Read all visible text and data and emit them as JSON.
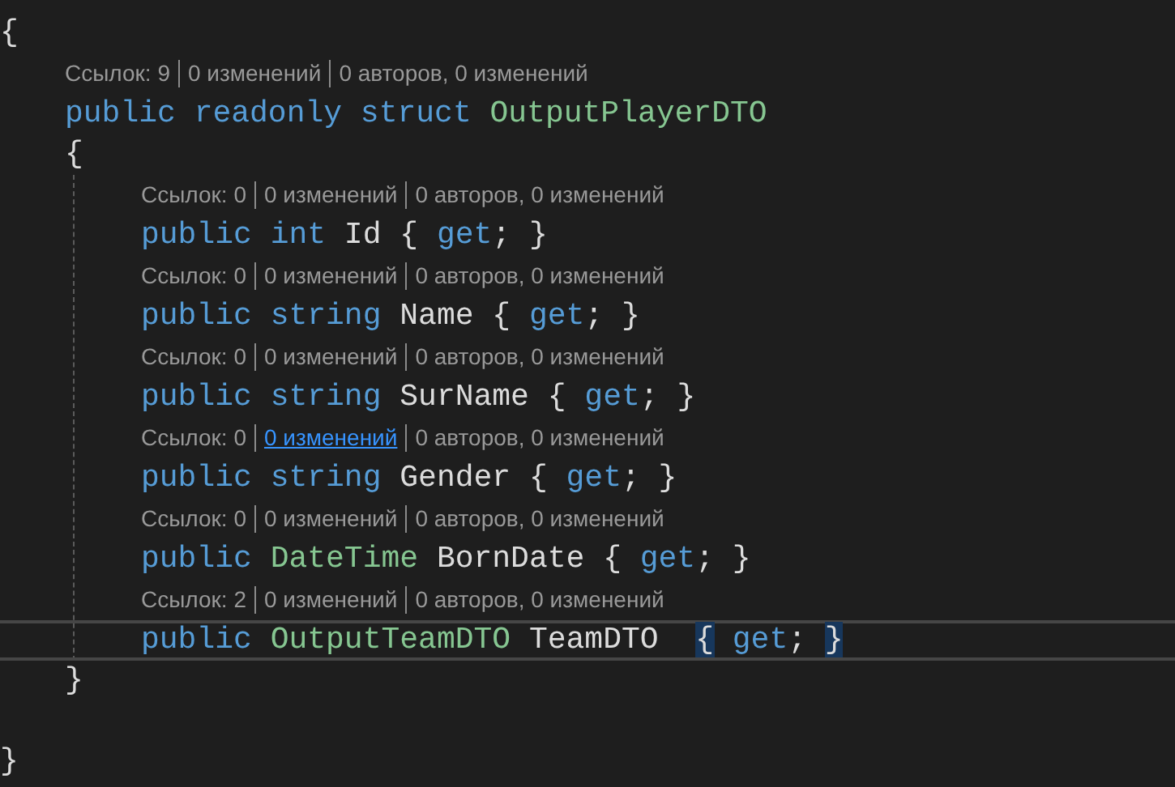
{
  "lines": [
    {
      "kind": "code",
      "current": false,
      "tokens": [
        {
          "text": "{",
          "kind": "plain",
          "matched": false
        }
      ],
      "children": [
        {
          "kind": "lens",
          "parts": [
            {
              "text": "Ссылок: 9",
              "link": false
            },
            {
              "text": "0 изменений",
              "link": false
            },
            {
              "text": "0 авторов, 0 изменений",
              "link": false
            }
          ]
        },
        {
          "kind": "code",
          "current": false,
          "tokens": [
            {
              "text": "public readonly struct ",
              "kind": "keyword",
              "matched": false
            },
            {
              "text": "OutputPlayerDTO",
              "kind": "type",
              "matched": false
            }
          ]
        },
        {
          "kind": "code",
          "current": false,
          "tokens": [
            {
              "text": "{",
              "kind": "plain",
              "matched": false
            }
          ],
          "children": [
            {
              "kind": "lens",
              "parts": [
                {
                  "text": "Ссылок: 0",
                  "link": false
                },
                {
                  "text": "0 изменений",
                  "link": false
                },
                {
                  "text": "0 авторов, 0 изменений",
                  "link": false
                }
              ]
            },
            {
              "kind": "code",
              "current": false,
              "tokens": [
                {
                  "text": "public int ",
                  "kind": "keyword",
                  "matched": false
                },
                {
                  "text": "Id { ",
                  "kind": "plain",
                  "matched": false
                },
                {
                  "text": "get",
                  "kind": "keyword",
                  "matched": false
                },
                {
                  "text": "; }",
                  "kind": "plain",
                  "matched": false
                }
              ]
            },
            {
              "kind": "lens",
              "parts": [
                {
                  "text": "Ссылок: 0",
                  "link": false
                },
                {
                  "text": "0 изменений",
                  "link": false
                },
                {
                  "text": "0 авторов, 0 изменений",
                  "link": false
                }
              ]
            },
            {
              "kind": "code",
              "current": false,
              "tokens": [
                {
                  "text": "public string ",
                  "kind": "keyword",
                  "matched": false
                },
                {
                  "text": "Name { ",
                  "kind": "plain",
                  "matched": false
                },
                {
                  "text": "get",
                  "kind": "keyword",
                  "matched": false
                },
                {
                  "text": "; }",
                  "kind": "plain",
                  "matched": false
                }
              ]
            },
            {
              "kind": "lens",
              "parts": [
                {
                  "text": "Ссылок: 0",
                  "link": false
                },
                {
                  "text": "0 изменений",
                  "link": false
                },
                {
                  "text": "0 авторов, 0 изменений",
                  "link": false
                }
              ]
            },
            {
              "kind": "code",
              "current": false,
              "tokens": [
                {
                  "text": "public string ",
                  "kind": "keyword",
                  "matched": false
                },
                {
                  "text": "SurName { ",
                  "kind": "plain",
                  "matched": false
                },
                {
                  "text": "get",
                  "kind": "keyword",
                  "matched": false
                },
                {
                  "text": "; }",
                  "kind": "plain",
                  "matched": false
                }
              ]
            },
            {
              "kind": "lens",
              "parts": [
                {
                  "text": "Ссылок: 0",
                  "link": false
                },
                {
                  "text": "0 изменений",
                  "link": true
                },
                {
                  "text": "0 авторов, 0 изменений",
                  "link": false
                }
              ]
            },
            {
              "kind": "code",
              "current": false,
              "tokens": [
                {
                  "text": "public string ",
                  "kind": "keyword",
                  "matched": false
                },
                {
                  "text": "Gender { ",
                  "kind": "plain",
                  "matched": false
                },
                {
                  "text": "get",
                  "kind": "keyword",
                  "matched": false
                },
                {
                  "text": "; }",
                  "kind": "plain",
                  "matched": false
                }
              ]
            },
            {
              "kind": "lens",
              "parts": [
                {
                  "text": "Ссылок: 0",
                  "link": false
                },
                {
                  "text": "0 изменений",
                  "link": false
                },
                {
                  "text": "0 авторов, 0 изменений",
                  "link": false
                }
              ]
            },
            {
              "kind": "code",
              "current": false,
              "tokens": [
                {
                  "text": "public ",
                  "kind": "keyword",
                  "matched": false
                },
                {
                  "text": "DateTime ",
                  "kind": "type",
                  "matched": false
                },
                {
                  "text": "BornDate { ",
                  "kind": "plain",
                  "matched": false
                },
                {
                  "text": "get",
                  "kind": "keyword",
                  "matched": false
                },
                {
                  "text": "; }",
                  "kind": "plain",
                  "matched": false
                }
              ]
            },
            {
              "kind": "lens",
              "parts": [
                {
                  "text": "Ссылок: 2",
                  "link": false
                },
                {
                  "text": "0 изменений",
                  "link": false
                },
                {
                  "text": "0 авторов, 0 изменений",
                  "link": false
                }
              ]
            },
            {
              "kind": "code",
              "current": true,
              "tokens": [
                {
                  "text": "public ",
                  "kind": "keyword",
                  "matched": false
                },
                {
                  "text": "OutputTeamDTO ",
                  "kind": "type",
                  "matched": false
                },
                {
                  "text": "TeamDTO  ",
                  "kind": "plain",
                  "matched": false
                },
                {
                  "text": "{",
                  "kind": "plain",
                  "matched": true
                },
                {
                  "text": " get",
                  "kind": "keyword",
                  "matched": false
                },
                {
                  "text": "; ",
                  "kind": "plain",
                  "matched": false
                },
                {
                  "text": "}",
                  "kind": "plain",
                  "matched": true
                }
              ]
            }
          ]
        },
        {
          "kind": "code",
          "current": false,
          "tokens": [
            {
              "text": "}",
              "kind": "plain",
              "matched": false
            }
          ]
        }
      ]
    },
    {
      "kind": "blank"
    },
    {
      "kind": "code",
      "current": false,
      "tokens": [
        {
          "text": "}",
          "kind": "plain",
          "matched": false
        }
      ]
    }
  ]
}
